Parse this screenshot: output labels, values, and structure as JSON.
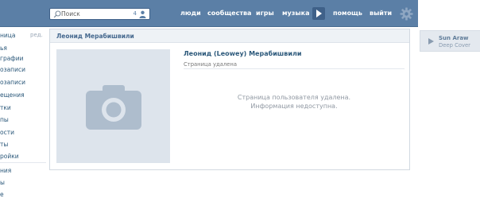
{
  "search": {
    "placeholder": "Поиск",
    "count": "4"
  },
  "nav": {
    "people": "люди",
    "communities": "сообщества",
    "games": "игры",
    "music": "музыка",
    "help": "помощь",
    "logout": "выйти"
  },
  "left_menu": {
    "edit": "ред.",
    "items": [
      "ница",
      "ья",
      "графии",
      "озаписи",
      "озаписи",
      "ещения",
      "тки",
      "пы",
      "ости",
      "ты",
      "ройки",
      "ния",
      "ы",
      "е"
    ]
  },
  "card": {
    "header": "Леонид Мерабишвили",
    "name": "Леонид (Leowey) Мерабишвили",
    "status": "Страница удалена",
    "message_line1": "Страница пользователя удалена.",
    "message_line2": "Информация недоступна."
  },
  "audio": {
    "artist": "Sun Araw",
    "track": "Deep Cover"
  },
  "colors": {
    "header_bg": "#5b7fa6",
    "link": "#2b587a",
    "photo_placeholder": "#dde4ec",
    "camera_icon": "#aebdcd"
  }
}
